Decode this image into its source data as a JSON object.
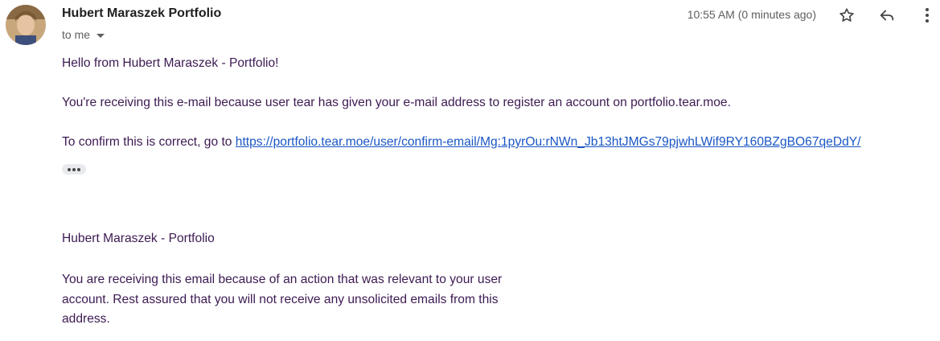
{
  "header": {
    "sender_name": "Hubert Maraszek Portfolio",
    "recipient_label": "to me",
    "timestamp": "10:55 AM (0 minutes ago)",
    "icons": {
      "avatar": "avatar-photo",
      "recipient_dropdown": "caret-down-icon",
      "star": "star-outline-icon",
      "reply": "reply-icon",
      "more": "more-vertical-icon"
    }
  },
  "message": {
    "greeting": "Hello from Hubert Maraszek - Portfolio!",
    "reason": "You're receiving this e-mail because user tear has given your e-mail address to register an account on portfolio.tear.moe.",
    "confirm_prefix": "To confirm this is correct, go to ",
    "confirm_link": "https://portfolio.tear.moe/user/confirm-email/Mg:1pyrOu:rNWn_Jb13htJMGs79pjwhLWif9RY160BZgBO67qeDdY/",
    "collapsed_content_icon": "ellipsis-icon",
    "footer_title": "Hubert Maraszek - Portfolio",
    "footer_note": "You are receiving this email because of an action that was relevant to your user account. Rest assured that you will not receive any unsolicited emails from this address."
  },
  "colors": {
    "body_text": "#3c1a52",
    "link": "#1a56c4",
    "secondary_text": "#5e5e5e"
  }
}
